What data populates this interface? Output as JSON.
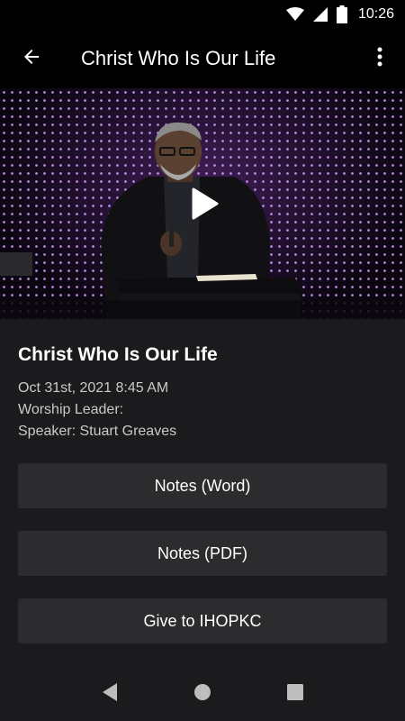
{
  "status_bar": {
    "time": "10:26",
    "icons": [
      "wifi-icon",
      "signal-icon",
      "battery-icon"
    ]
  },
  "app_bar": {
    "title": "Christ Who Is Our Life",
    "back_icon": "arrow-back-icon",
    "menu_icon": "more-vertical-icon"
  },
  "video": {
    "play_icon": "play-icon"
  },
  "sermon": {
    "title": "Christ Who Is Our Life",
    "date": "Oct 31st, 2021 8:45 AM",
    "worship_leader": "Worship Leader:",
    "speaker": "Speaker: Stuart Greaves"
  },
  "actions": {
    "notes_word": "Notes (Word)",
    "notes_pdf": "Notes (PDF)",
    "give": "Give to IHOPKC"
  },
  "nav_bar": {
    "icons": [
      "nav-back-icon",
      "nav-home-icon",
      "nav-recents-icon"
    ]
  },
  "colors": {
    "background": "#1b1b1d",
    "button": "#2c2c2e",
    "bar": "#000000",
    "text_secondary": "#c9c9c9"
  }
}
